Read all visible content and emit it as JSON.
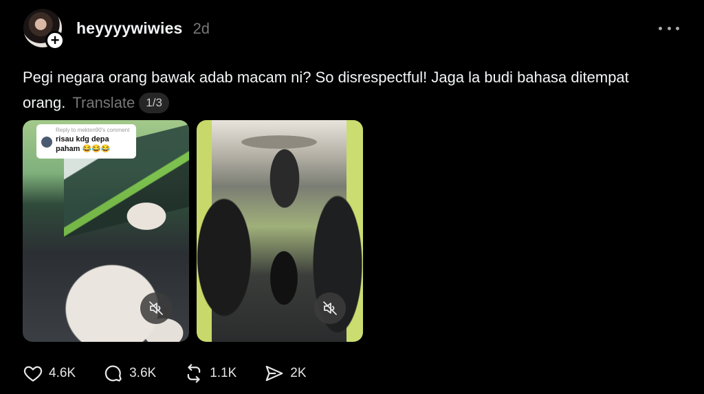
{
  "post": {
    "username": "heyyyywiwies",
    "time": "2d",
    "follow_symbol": "+",
    "text": "Pegi negara orang bawak adab macam ni? So disrespectful! Jaga la budi bahasa ditempat orang.",
    "translate_label": "Translate",
    "page_indicator": "1/3"
  },
  "media": [
    {
      "type": "video",
      "reply_card": {
        "header": "Reply to mekten90's comment",
        "text": "risau kdg depa paham 😂😂😂"
      },
      "muted_icon": "speaker-muted-icon"
    },
    {
      "type": "video",
      "muted_icon": "speaker-muted-icon"
    }
  ],
  "actions": {
    "like_count": "4.6K",
    "comment_count": "3.6K",
    "repost_count": "1.1K",
    "share_count": "2K"
  }
}
